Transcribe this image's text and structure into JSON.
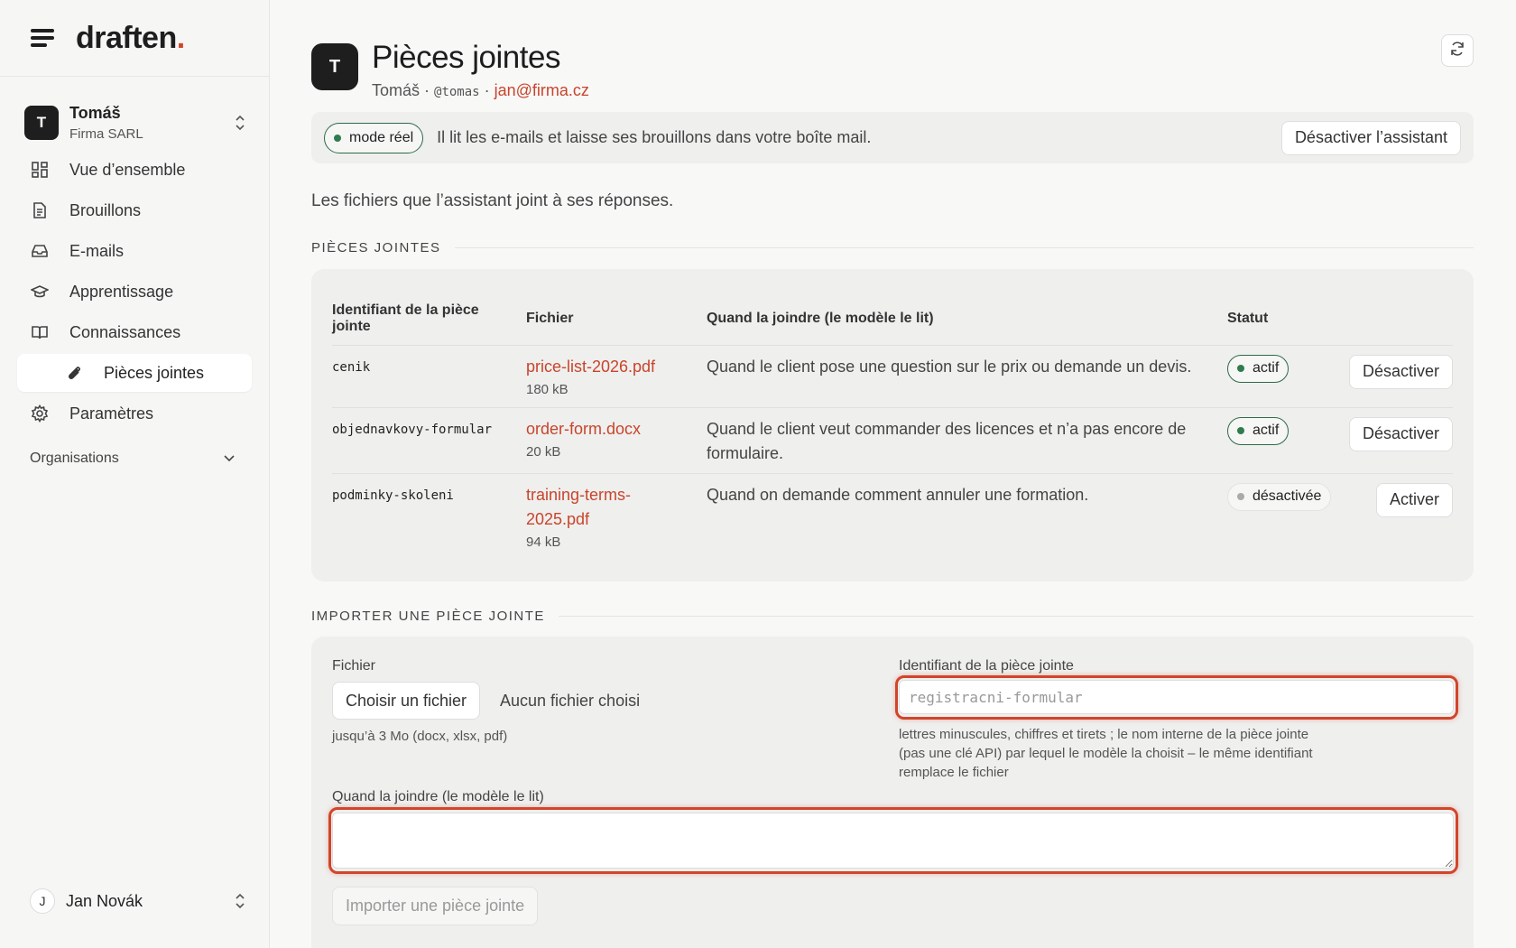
{
  "brand": {
    "name": "draften",
    "dot": "."
  },
  "org_switcher": {
    "initial": "T",
    "name": "Tomáš",
    "company": "Firma SARL"
  },
  "nav": {
    "overview": "Vue d’ensemble",
    "drafts": "Brouillons",
    "emails": "E-mails",
    "learning": "Apprentissage",
    "knowledge": "Connaissances",
    "attachments": "Pièces jointes",
    "settings": "Paramètres"
  },
  "organisations_label": "Organisations",
  "user": {
    "initial": "J",
    "name": "Jan Novák"
  },
  "header": {
    "initial": "T",
    "title": "Pièces jointes",
    "name": "Tomáš",
    "handle": "@tomas",
    "email": "jan@firma.cz"
  },
  "banner": {
    "mode": "mode réel",
    "text": "Il lit les e-mails et laisse ses brouillons dans votre boîte mail.",
    "button": "Désactiver l’assistant"
  },
  "intro": "Les fichiers que l’assistant joint à ses réponses.",
  "attachments_section": "PIÈCES JOINTES",
  "table": {
    "col_id_line1": "Identifiant de la pièce",
    "col_id_line2": "jointe",
    "col_file": "Fichier",
    "col_when": "Quand la joindre (le modèle le lit)",
    "col_status": "Statut",
    "rows": [
      {
        "id": "cenik",
        "file": "price-list-2026.pdf",
        "size": "180 kB",
        "when": "Quand le client pose une question sur le prix ou demande un devis.",
        "status": "actif",
        "action": "Désactiver"
      },
      {
        "id": "objednavkovy-formular",
        "file": "order-form.docx",
        "size": "20 kB",
        "when": "Quand le client veut commander des licences et n’a pas encore de formulaire.",
        "status": "actif",
        "action": "Désactiver"
      },
      {
        "id": "podminky-skoleni",
        "file": "training-terms-2025.pdf",
        "size": "94 kB",
        "when": "Quand on demande comment annuler une formation.",
        "status": "désactivée",
        "action": "Activer"
      }
    ]
  },
  "import_section": "IMPORTER UNE PIÈCE JOINTE",
  "form": {
    "file_label": "Fichier",
    "choose_button": "Choisir un fichier",
    "no_file": "Aucun fichier choisi",
    "file_hint": "jusqu’à 3 Mo (docx, xlsx, pdf)",
    "id_label": "Identifiant de la pièce jointe",
    "id_placeholder": "registracni-formular",
    "id_hint_line1": "lettres minuscules, chiffres et tirets ; le nom interne de la pièce jointe",
    "id_hint_line2": "(pas une clé API) par lequel le modèle la choisit – le même identifiant",
    "id_hint_line3": "remplace le fichier",
    "when_label": "Quand la joindre (le modèle le lit)",
    "submit": "Importer une pièce jointe"
  },
  "colors": {
    "accent": "#c8452c",
    "active_green": "#2f7d4f",
    "dark": "#1e1e1e"
  }
}
